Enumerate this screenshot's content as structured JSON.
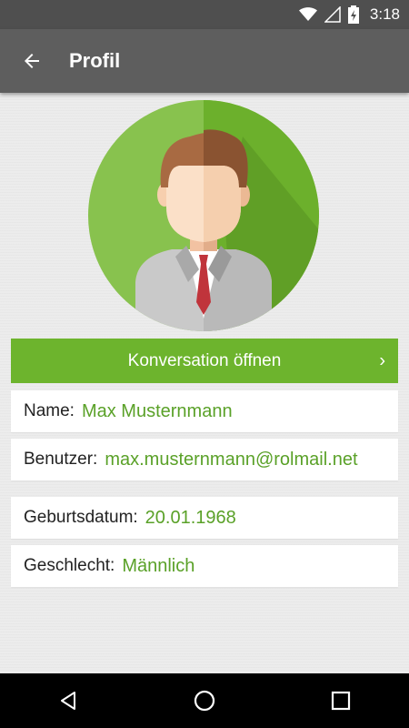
{
  "status_bar": {
    "time": "3:18",
    "icons": [
      "wifi-icon",
      "signal-icon",
      "battery-charging-icon"
    ]
  },
  "app_bar": {
    "title": "Profil",
    "back_icon": "arrow-back-icon"
  },
  "profile": {
    "avatar_icon": "male-avatar-icon",
    "accent_color": "#6db42d",
    "conversation_button": {
      "label": "Konversation öffnen",
      "chevron": "›"
    },
    "fields": [
      {
        "label": "Name:",
        "value": "Max Musternmann"
      },
      {
        "label": "Benutzer:",
        "value": "max.musternmann@rolmail.net"
      },
      {
        "label": "Geburtsdatum:",
        "value": "20.01.1968"
      },
      {
        "label": "Geschlecht:",
        "value": "Männlich"
      }
    ]
  },
  "nav_bar": {
    "buttons": [
      "back-triangle-icon",
      "home-circle-icon",
      "recents-square-icon"
    ]
  }
}
